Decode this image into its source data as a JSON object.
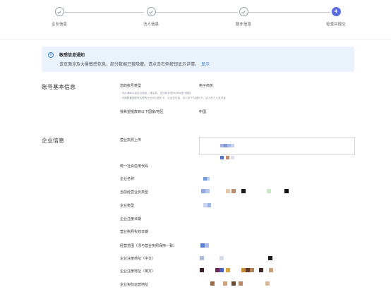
{
  "steps": [
    {
      "label": "企业信息",
      "state": "done"
    },
    {
      "label": "法人信息",
      "state": "done"
    },
    {
      "label": "股东信息",
      "state": "done"
    },
    {
      "label": "检查并提交",
      "state": "active",
      "number": "4"
    }
  ],
  "notice": {
    "icon": "info-icon",
    "title": "敏感信息通知",
    "text": "该页面涉及大量敏感信息，部分数据已被隐藏。请点击右侧按钮显示详情。",
    "link": "显示"
  },
  "account_section": {
    "title": "账号基本信息",
    "account_type_label": "您的账号类型",
    "account_type_value": "电子商务",
    "hint_line1": "- 可从海库平台出口商品，请注意，支付网关或PayPal进行收款",
    "hint_line2": "- 可请配置您账号名称的企业对公银行卡，企业支付宝，法人的个人银行卡，法人的个人支付宝",
    "region_label": "我希望提款到以下国家/地区",
    "region_value": "中国"
  },
  "company_section": {
    "title": "企业信息",
    "fields": [
      {
        "label": "营业执照上传"
      },
      {
        "label": "统一社会信用代码"
      },
      {
        "label": "企业名称"
      },
      {
        "label": "当前经营业务类型"
      },
      {
        "label": "企业类型"
      },
      {
        "label": "企业注册日期"
      },
      {
        "label": "营业执照失效日期"
      },
      {
        "label": "经营范围（须与营业执照保持一致）"
      },
      {
        "label": "企业注册地址（中文）"
      },
      {
        "label": "企业注册地址（英文）"
      },
      {
        "label": "企业实际运营地址"
      }
    ]
  },
  "colors": {
    "accent": "#5b6ee1",
    "link": "#3b82d6",
    "notice_bg": "#eaf2fb"
  }
}
